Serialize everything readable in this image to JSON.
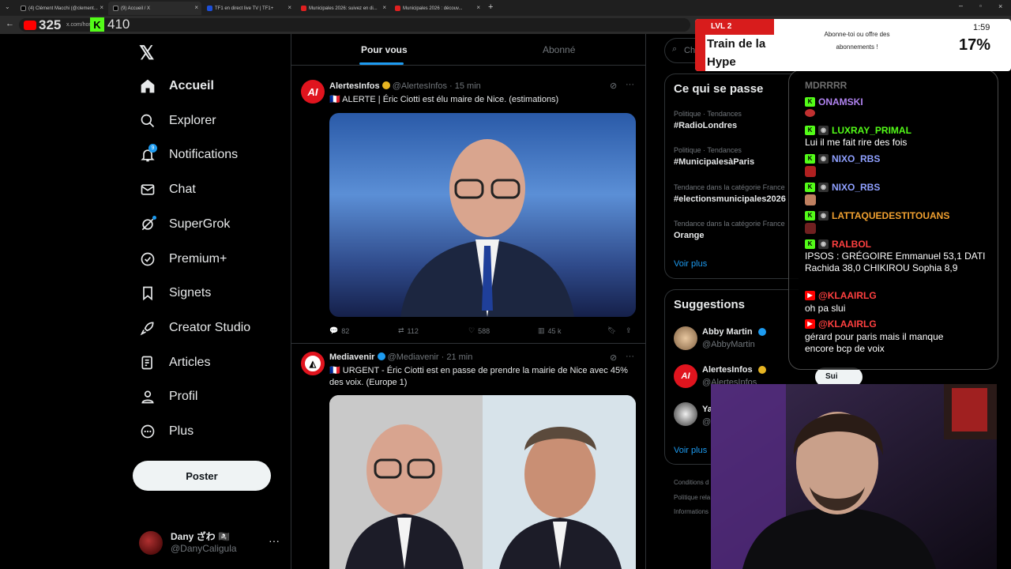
{
  "tabs": [
    {
      "title": "(4) Clément Macchi (@clement...",
      "active": false
    },
    {
      "title": "(9) Accueil / X",
      "active": true
    },
    {
      "title": "TF1 en direct live TV | TF1+",
      "active": false
    },
    {
      "title": "Municipales 2026: suivez en di...",
      "active": false
    },
    {
      "title": "Municipales 2026 : découv...",
      "active": false
    }
  ],
  "address": "x.com/home",
  "overlay_counts": {
    "youtube": "325",
    "kick": "410"
  },
  "nav": {
    "items": [
      {
        "label": "Accueil",
        "icon": "home-icon",
        "bold": true
      },
      {
        "label": "Explorer",
        "icon": "search-icon"
      },
      {
        "label": "Notifications",
        "icon": "bell-icon",
        "badge": "9"
      },
      {
        "label": "Chat",
        "icon": "mail-icon"
      },
      {
        "label": "SuperGrok",
        "icon": "grok-icon"
      },
      {
        "label": "Premium+",
        "icon": "verified-icon"
      },
      {
        "label": "Signets",
        "icon": "bookmark-icon"
      },
      {
        "label": "Creator Studio",
        "icon": "rocket-icon"
      },
      {
        "label": "Articles",
        "icon": "article-icon"
      },
      {
        "label": "Profil",
        "icon": "person-icon"
      },
      {
        "label": "Plus",
        "icon": "more-circle-icon"
      }
    ],
    "post_label": "Poster"
  },
  "account": {
    "name": "Dany ざわ 🏴‍☠️",
    "handle": "@DanyCaligula"
  },
  "feed_tabs": [
    "Pour vous",
    "Abonné"
  ],
  "tweets": [
    {
      "name": "AlertesInfos",
      "handle": "@AlertesInfos",
      "time": "· 15 min",
      "text": "🇫🇷 ALERTE | Éric Ciotti est élu maire de Nice. (estimations)",
      "replies": "82",
      "retweets": "112",
      "likes": "588",
      "views": "45 k"
    },
    {
      "name": "Mediavenir",
      "handle": "@Mediavenir",
      "time": "· 21 min",
      "text": "🇫🇷 URGENT - Éric Ciotti est en passe de prendre la mairie de Nice avec 45% des voix. (Europe 1)"
    }
  ],
  "search": {
    "placeholder": "Ch"
  },
  "trends": {
    "title": "Ce qui se passe",
    "items": [
      {
        "sub": "Politique · Tendances",
        "tag": "#RadioLondres"
      },
      {
        "sub": "Politique · Tendances",
        "tag": "#MunicipalesàParis"
      },
      {
        "sub": "Tendance dans la catégorie France",
        "tag": "#electionsmunicipales2026"
      },
      {
        "sub": "Tendance dans la catégorie France",
        "tag": "Orange"
      }
    ],
    "more": "Voir plus"
  },
  "suggestions": {
    "title": "Suggestions",
    "items": [
      {
        "name": "Abby Martin",
        "handle": "@AbbyMartin"
      },
      {
        "name": "AlertesInfos",
        "handle": "@AlertesInfos"
      },
      {
        "name": "Ya",
        "handle": "@"
      }
    ],
    "follow": "Sui",
    "more": "Voir plus"
  },
  "footer": [
    "Conditions d",
    "Politique rela",
    "Informations"
  ],
  "hype": {
    "level": "LVL 2",
    "title": "Train de la Hype",
    "message": "Abonne-toi ou offre des abonnements !",
    "time": "1:59",
    "percent": "17%"
  },
  "chat": [
    {
      "user": "MDRRRR",
      "platform": "none",
      "color": "#6f6f6f",
      "text": ""
    },
    {
      "user": "ONAMSKI",
      "platform": "kick",
      "color": "#b083f0",
      "text": ""
    },
    {
      "user": "LUXRAY_PRIMAL",
      "platform": "kick",
      "color": "#53fc18",
      "text": "Lui il me fait rire des fois"
    },
    {
      "user": "NIXO_RBS",
      "platform": "kick",
      "color": "#8fa0ff",
      "text": ""
    },
    {
      "user": "NIXO_RBS",
      "platform": "kick",
      "color": "#8fa0ff",
      "text": ""
    },
    {
      "user": "LATTAQUEDESTITOUANS",
      "platform": "kick",
      "color": "#f0a030",
      "text": ""
    },
    {
      "user": "RALBOL",
      "platform": "kick",
      "color": "#ff4040",
      "text": "IPSOS : GRÉGOIRE Emmanuel 53,1 DATI Rachida 38,0 CHIKIROU Sophia 8,9"
    },
    {
      "user": "@KLAAIRLG",
      "platform": "youtube",
      "color": "#ff4040",
      "text": "oh pa slui"
    },
    {
      "user": "@KLAAIRLG",
      "platform": "youtube",
      "color": "#ff4040",
      "text": "gérard pour paris mais il manque encore bcp de voix"
    }
  ]
}
